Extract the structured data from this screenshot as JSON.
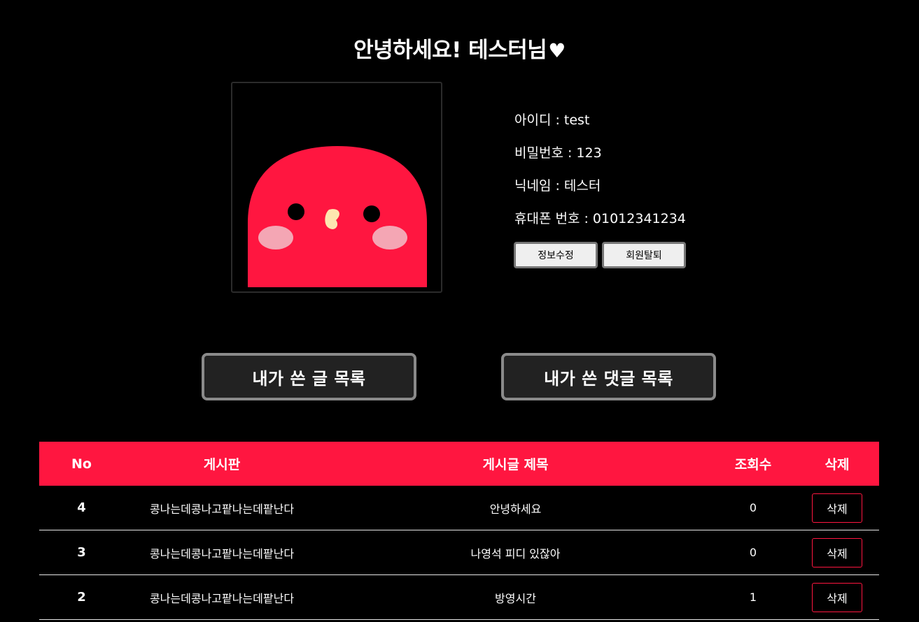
{
  "greeting": {
    "text": "안녕하세요! 테스터님",
    "heart": "♥"
  },
  "profile": {
    "avatar_icon": "red-bird-avatar-icon",
    "colors": {
      "body": "#ff1640",
      "cheek": "#f4a6b4",
      "beak": "#fde6b0",
      "eye": "#000000"
    },
    "rows": [
      {
        "label": "아이디 : ",
        "value": "test"
      },
      {
        "label": "비밀번호 : ",
        "value": "123"
      },
      {
        "label": "닉네임 : ",
        "value": "테스터"
      },
      {
        "label": "휴대폰 번호 : ",
        "value": "01012341234"
      }
    ],
    "edit_label": "정보수정",
    "withdraw_label": "회원탈퇴"
  },
  "tabs": {
    "posts_label": "내가 쓴 글 목록",
    "comments_label": "내가 쓴 댓글 목록"
  },
  "table": {
    "accent": "#ff1640",
    "headers": {
      "no": "No",
      "board": "게시판",
      "title": "게시글 제목",
      "views": "조회수",
      "delete": "삭제"
    },
    "rows": [
      {
        "no": "4",
        "board": "콩나는데콩나고팥나는데팥난다",
        "title": "안녕하세요",
        "views": "0",
        "delete": "삭제"
      },
      {
        "no": "3",
        "board": "콩나는데콩나고팥나는데팥난다",
        "title": "나영석 피디 있잖아",
        "views": "0",
        "delete": "삭제"
      },
      {
        "no": "2",
        "board": "콩나는데콩나고팥나는데팥난다",
        "title": "방영시간",
        "views": "1",
        "delete": "삭제"
      }
    ]
  }
}
